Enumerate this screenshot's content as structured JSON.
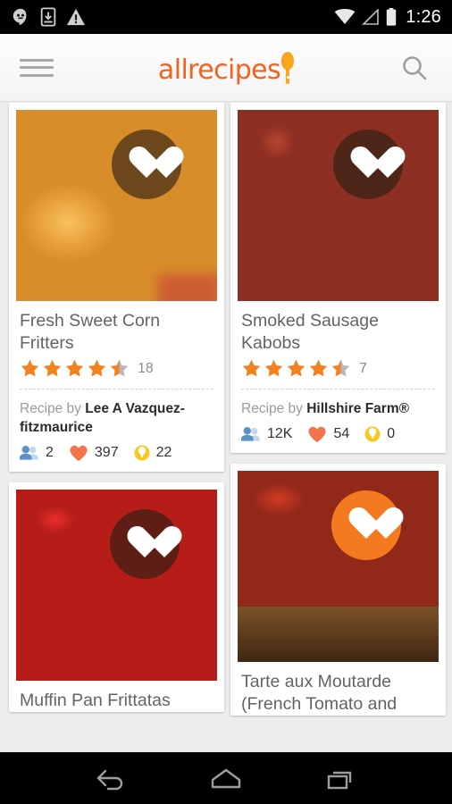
{
  "statusbar": {
    "time": "1:26",
    "icons": [
      "hangouts-icon",
      "download-icon",
      "warning-icon",
      "wifi-icon",
      "cell-signal-icon",
      "battery-icon"
    ]
  },
  "appbar": {
    "menu_label": "menu-icon",
    "brand": "allrecipes",
    "brand_color": "#f4611c",
    "spoon_color": "#f9a61a",
    "search_label": "search-icon"
  },
  "feed": {
    "cards": [
      {
        "title": "Fresh Sweet Corn Fritters",
        "rating": 4.5,
        "review_count": "18",
        "by_prefix": "Recipe by ",
        "author": "Lee A Vazquez-fitzmaurice",
        "favorited": false,
        "stats": [
          {
            "icon": "made-it-icon",
            "value": "2"
          },
          {
            "icon": "heart-icon",
            "value": "397"
          },
          {
            "icon": "photo-icon",
            "value": "22"
          }
        ]
      },
      {
        "title": "Smoked Sausage Kabobs",
        "rating": 4.5,
        "review_count": "7",
        "by_prefix": "Recipe by ",
        "author": "Hillshire Farm®",
        "favorited": false,
        "stats": [
          {
            "icon": "made-it-icon",
            "value": "12K"
          },
          {
            "icon": "heart-icon",
            "value": "54"
          },
          {
            "icon": "photo-icon",
            "value": "0"
          }
        ]
      },
      {
        "title": "Muffin Pan Frittatas",
        "favorited": false
      },
      {
        "title": "Tarte aux Moutarde (French Tomato and",
        "favorited": true
      }
    ]
  },
  "navbar": {
    "back": "back-icon",
    "home": "home-icon",
    "recents": "recents-icon"
  },
  "colors": {
    "accent": "#f47a20",
    "star": "#f4811f",
    "star_empty": "#b7b7b7",
    "background": "#ececec",
    "card": "#ffffff"
  }
}
